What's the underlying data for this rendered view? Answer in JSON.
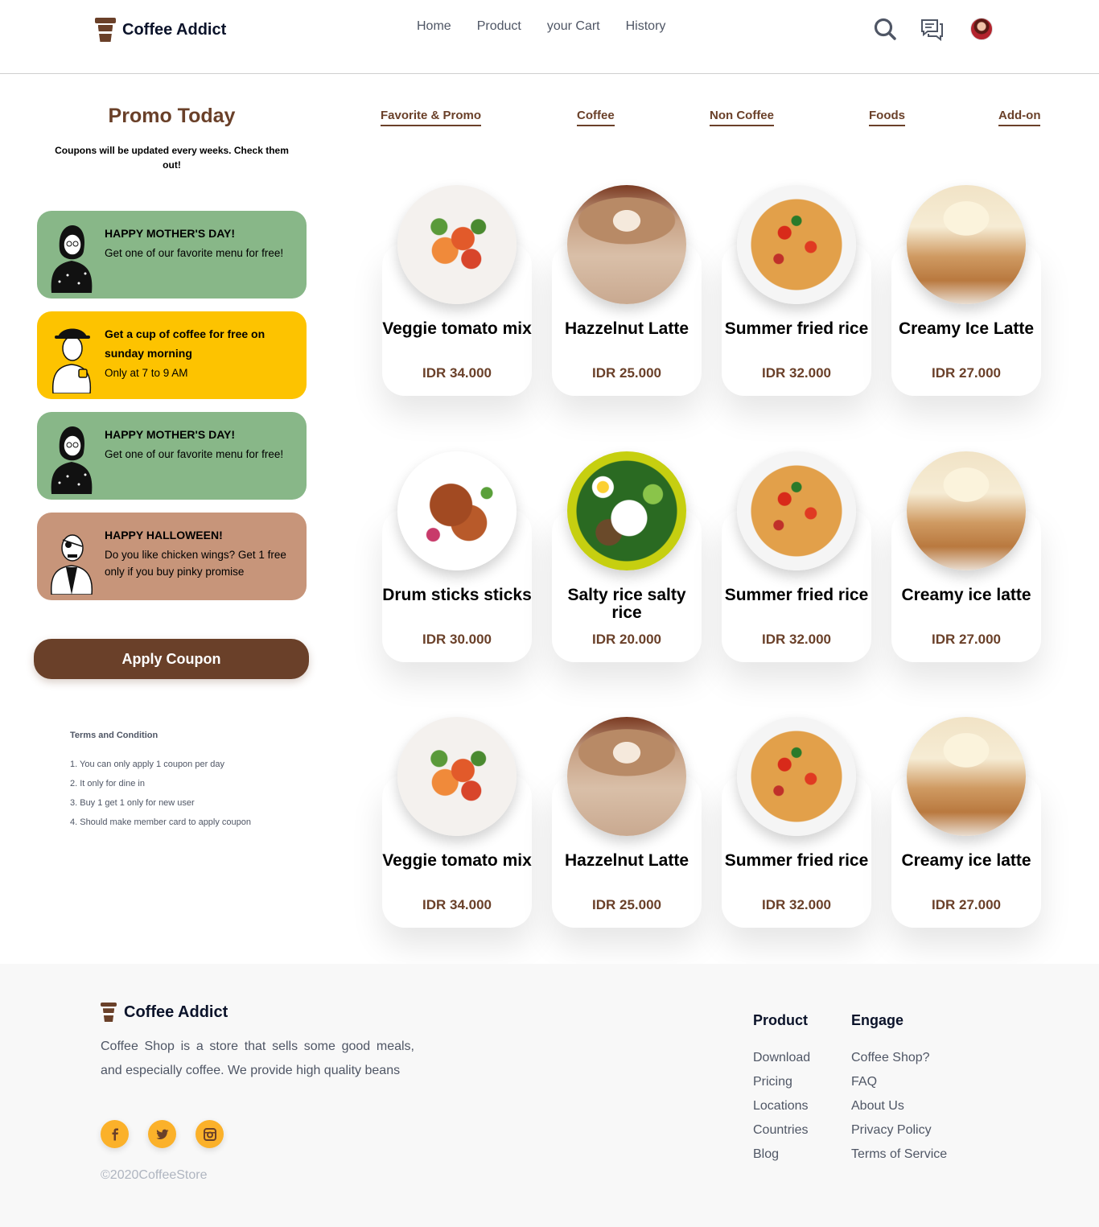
{
  "header": {
    "brand": "Coffee Addict",
    "nav": [
      "Home",
      "Product",
      "your Cart",
      "History"
    ],
    "icons": [
      "search-icon",
      "chat-icon",
      "avatar"
    ]
  },
  "promo": {
    "title": "Promo Today",
    "subtitle": "Coupons will be updated every weeks. Check them out!",
    "coupons": [
      {
        "title": "HAPPY MOTHER'S DAY!",
        "desc": "Get one of our favorite menu for free!",
        "color": "#88b788"
      },
      {
        "title": "Get a cup of coffee for free on sunday morning",
        "desc": "Only at 7 to 9 AM",
        "color": "#f5c361"
      },
      {
        "title": "HAPPY MOTHER'S DAY!",
        "desc": "Get one of our favorite menu for free!",
        "color": "#88b788"
      },
      {
        "title": "HAPPY HALLOWEEN!",
        "desc": "Do you like chicken wings? Get 1 free only if you buy pinky promise",
        "color": "#c7a087"
      }
    ],
    "apply_label": "Apply Coupon",
    "terms_title": "Terms and Condition",
    "terms": [
      "1. You can only apply 1 coupon per day",
      "2. It only for dine in",
      "3. Buy 1 get 1 only for new user",
      "4. Should make member card to apply coupon"
    ]
  },
  "tabs": [
    "Favorite & Promo",
    "Coffee",
    "Non Coffee",
    "Foods",
    "Add-on"
  ],
  "products": [
    {
      "name": "Veggie tomato mix",
      "price": "IDR 34.000",
      "image": "veggie"
    },
    {
      "name": "Hazzelnut Latte",
      "price": "IDR 25.000",
      "image": "latte"
    },
    {
      "name": "Summer fried rice",
      "price": "IDR 32.000",
      "image": "rice"
    },
    {
      "name": "Creamy Ice Latte",
      "price": "IDR 27.000",
      "image": "creamy"
    },
    {
      "name": "Drum sticks sticks",
      "price": "IDR 30.000",
      "image": "drum"
    },
    {
      "name": "Salty rice salty rice",
      "price": "IDR 20.000",
      "image": "salty"
    },
    {
      "name": "Summer fried rice",
      "price": "IDR 32.000",
      "image": "rice"
    },
    {
      "name": "Creamy ice latte",
      "price": "IDR 27.000",
      "image": "creamy"
    },
    {
      "name": "Veggie tomato mix",
      "price": "IDR 34.000",
      "image": "veggie"
    },
    {
      "name": "Hazzelnut Latte",
      "price": "IDR 25.000",
      "image": "latte"
    },
    {
      "name": "Summer fried rice",
      "price": "IDR 32.000",
      "image": "rice"
    },
    {
      "name": "Creamy ice latte",
      "price": "IDR 27.000",
      "image": "creamy"
    }
  ],
  "footer": {
    "brand": "Coffee Addict",
    "description": "Coffee Shop is a store that sells some good meals, and especially coffee. We provide high quality beans",
    "socials": [
      "facebook-icon",
      "twitter-icon",
      "instagram-icon"
    ],
    "copyright": "©2020CoffeeStore",
    "columns": [
      {
        "title": "Product",
        "links": [
          "Download",
          "Pricing",
          "Locations",
          "Countries",
          "Blog"
        ]
      },
      {
        "title": "Engage",
        "links": [
          "Coffee Shop?",
          "FAQ",
          "About Us",
          "Privacy Policy",
          "Terms of Service"
        ]
      }
    ]
  },
  "colors": {
    "brand_brown": "#6a4029",
    "accent_yellow": "#fbb12a",
    "text_dark": "#0b132a",
    "text_gray": "#4f5665"
  }
}
